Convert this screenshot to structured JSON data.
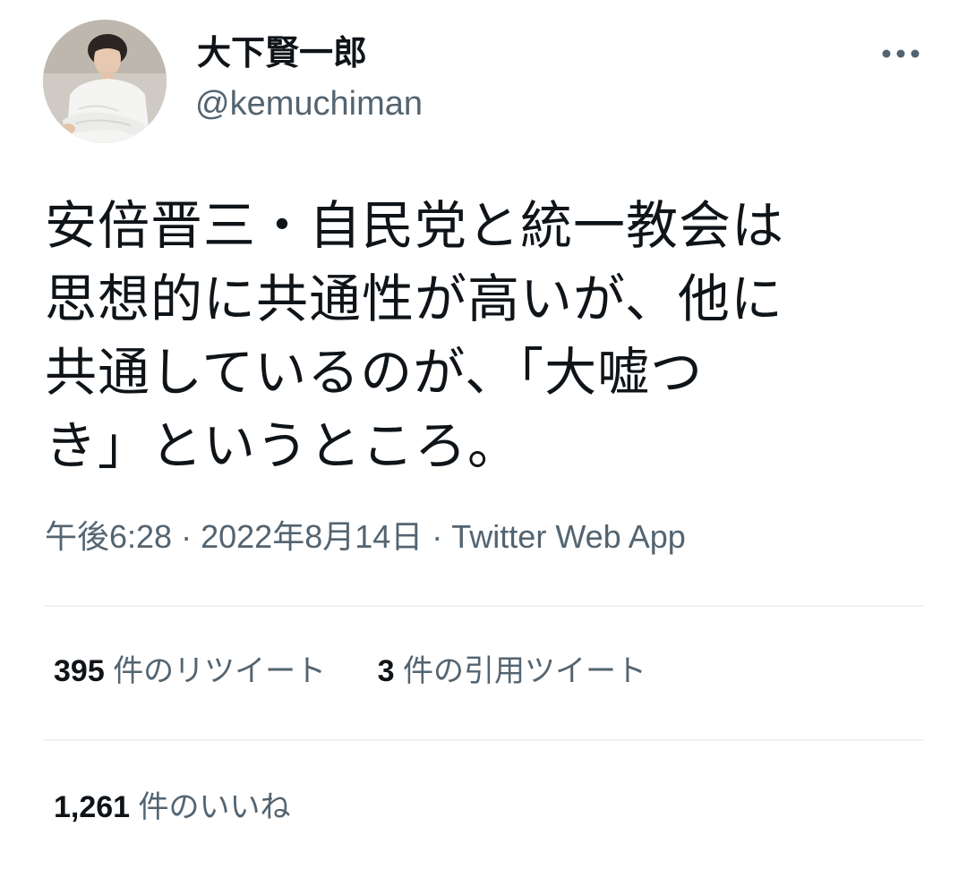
{
  "user": {
    "display_name": "大下賢一郎",
    "handle": "@kemuchiman",
    "avatar_icon": "user-avatar"
  },
  "more_icon": "more-horizontal-icon",
  "tweet": {
    "lines": [
      "安倍晋三・自民党と統一教会は",
      "思想的に共通性が高いが、他に",
      "共通しているのが、「大嘘つ",
      "き」というところ。"
    ],
    "time": "午後6:28",
    "separator": "·",
    "date": "2022年8月14日",
    "source": "Twitter Web App"
  },
  "stats": {
    "retweets": {
      "count": "395",
      "label": "件のリツイート"
    },
    "quotes": {
      "count": "3",
      "label": "件の引用ツイート"
    },
    "likes": {
      "count": "1,261",
      "label": "件のいいね"
    }
  },
  "colors": {
    "text_primary": "#0f1419",
    "text_secondary": "#536471",
    "divider": "#eff3f4"
  }
}
